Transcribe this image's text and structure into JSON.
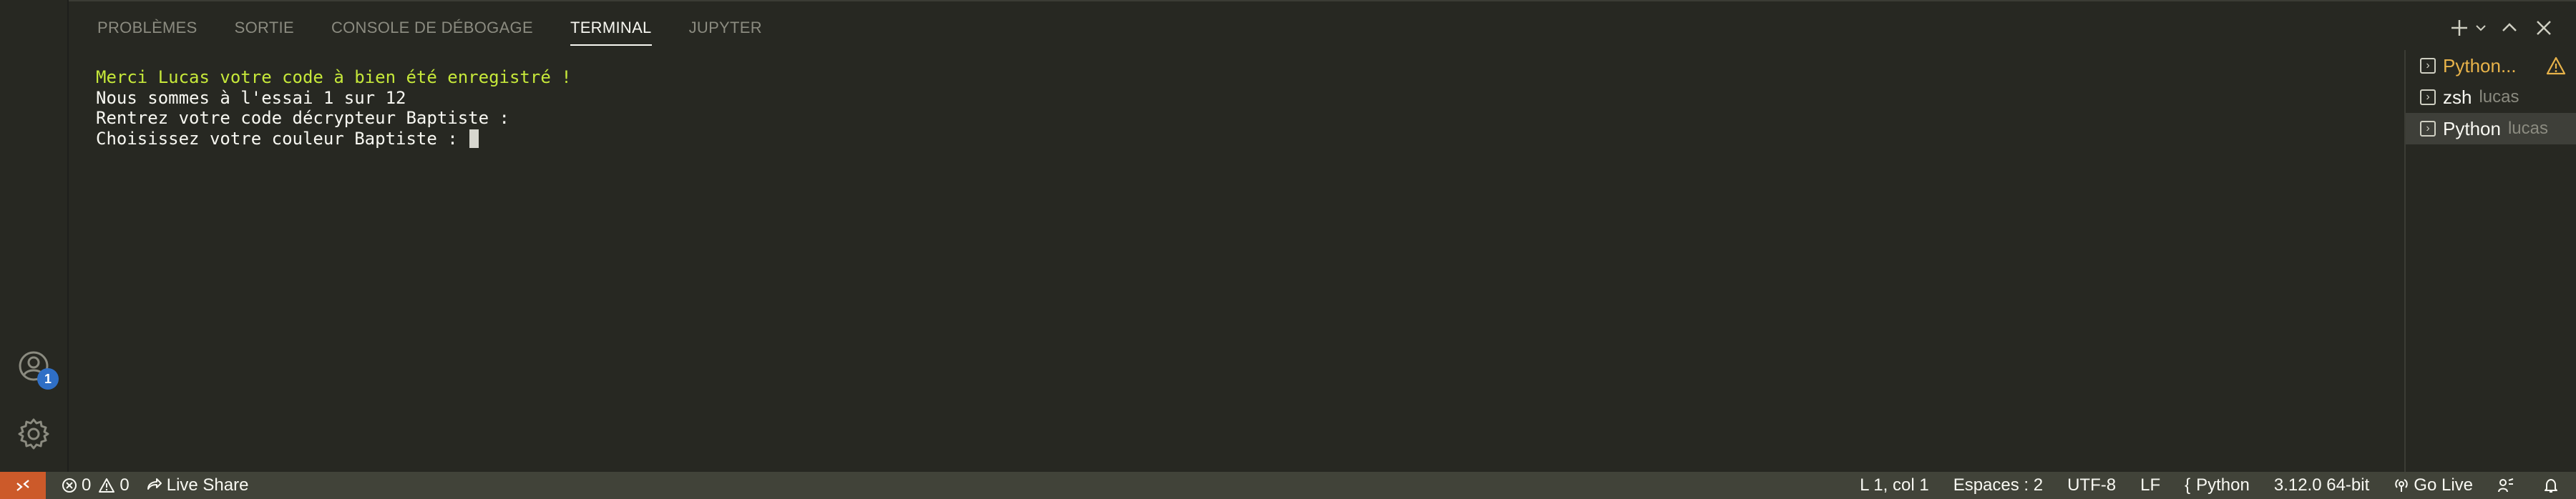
{
  "tabs": [
    "PROBLÈMES",
    "SORTIE",
    "CONSOLE DE DÉBOGAGE",
    "TERMINAL",
    "JUPYTER"
  ],
  "active_tab": "TERMINAL",
  "account_badge": "1",
  "terminal": {
    "lines": [
      "Merci Lucas votre code à bien été enregistré !",
      "Nous sommes à l'essai 1 sur 12",
      "Rentrez votre code décrypteur Baptiste :",
      "Choisissez votre couleur Baptiste : "
    ]
  },
  "terminal_list": [
    {
      "name": "Python...",
      "sub": "",
      "warning": true
    },
    {
      "name": "zsh",
      "sub": "lucas",
      "warning": false
    },
    {
      "name": "Python",
      "sub": "lucas",
      "warning": false
    }
  ],
  "statusbar": {
    "errors": "0",
    "warnings": "0",
    "live_share": "Live Share",
    "position": "L 1, col 1",
    "spaces": "Espaces : 2",
    "encoding": "UTF-8",
    "eol": "LF",
    "language": "Python",
    "interpreter": "3.12.0 64-bit",
    "go_live": "Go Live"
  },
  "colors": {
    "accent_remote": "#cc5a2a",
    "badge": "#2f6fc6",
    "terminal_green": "#c6e83a",
    "warning": "#e8b34a"
  }
}
